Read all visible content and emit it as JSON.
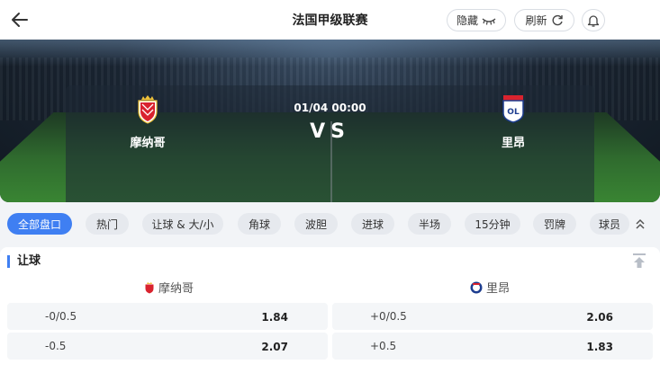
{
  "header": {
    "title": "法国甲级联赛",
    "hide_label": "隐藏",
    "refresh_label": "刷新"
  },
  "match": {
    "home_team": "摩纳哥",
    "away_team": "里昂",
    "datetime": "01/04 00:00",
    "vs": "VS"
  },
  "tabs": [
    "全部盘口",
    "热门",
    "让球 & 大/小",
    "角球",
    "波胆",
    "进球",
    "半场",
    "15分钟",
    "罚牌",
    "球员"
  ],
  "active_tab": "全部盘口",
  "handicap": {
    "section_title": "让球",
    "home_label": "摩纳哥",
    "away_label": "里昂",
    "rows": [
      {
        "home_line": "-0/0.5",
        "home_odds": "1.84",
        "away_line": "+0/0.5",
        "away_odds": "2.06"
      },
      {
        "home_line": "-0.5",
        "home_odds": "2.07",
        "away_line": "+0.5",
        "away_odds": "1.83"
      }
    ]
  },
  "colors": {
    "accent": "#3f7ff2",
    "monaco_red": "#d9232e",
    "lyon_blue": "#1d3d8f"
  },
  "icons": [
    "back-arrow-icon",
    "eye-closed-icon",
    "refresh-icon",
    "bell-icon",
    "chevrons-up-icon",
    "scroll-top-icon"
  ]
}
